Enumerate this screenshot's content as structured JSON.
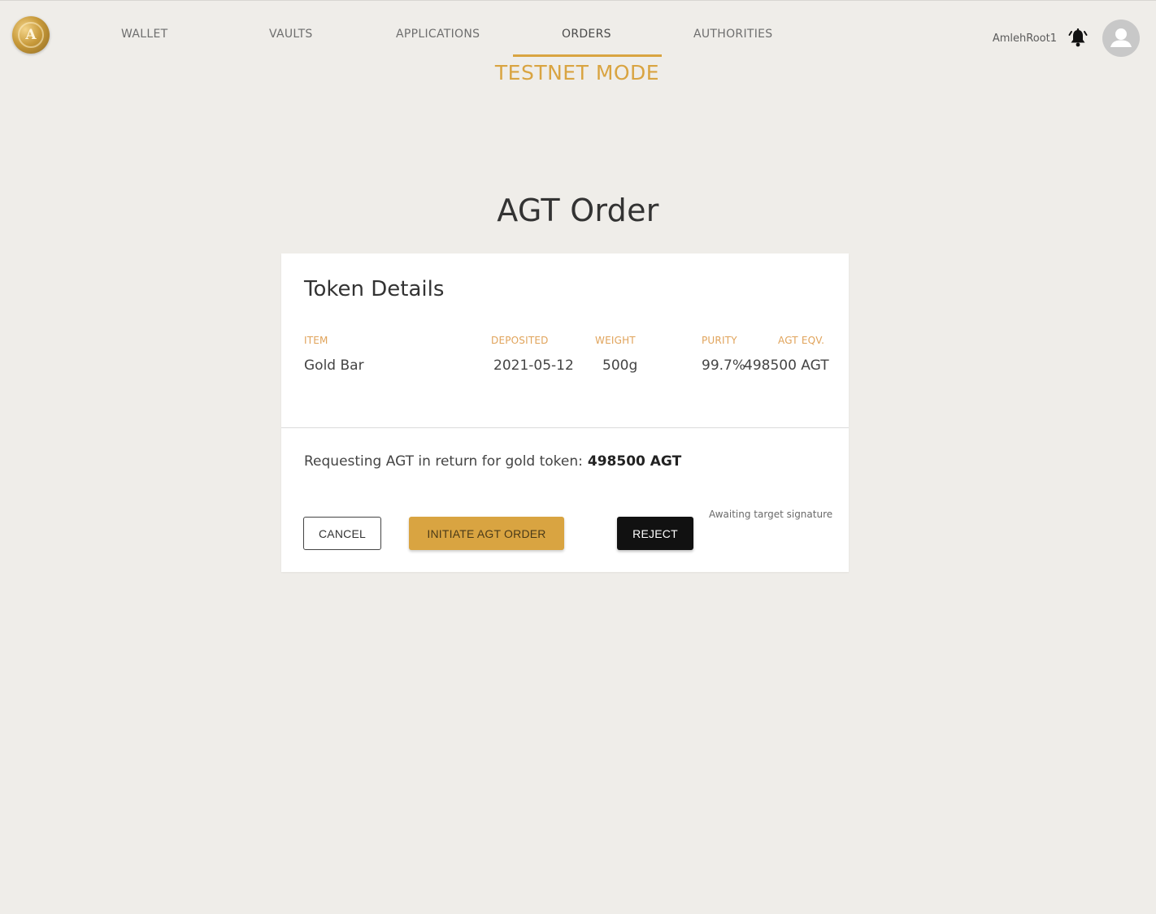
{
  "header": {
    "logo_letter": "A",
    "nav": [
      {
        "label": "WALLET"
      },
      {
        "label": "VAULTS"
      },
      {
        "label": "APPLICATIONS"
      },
      {
        "label": "ORDERS"
      },
      {
        "label": "AUTHORITIES"
      }
    ],
    "active_nav": "ORDERS",
    "mode_banner": "TESTNET MODE",
    "username": "AmlehRoot1",
    "icons": {
      "notifications": "bell-icon",
      "profile": "user-avatar-icon"
    }
  },
  "page": {
    "title": "AGT Order"
  },
  "card": {
    "title": "Token Details",
    "columns": [
      "ITEM",
      "DEPOSITED",
      "WEIGHT",
      "PURITY",
      "AGT EQV."
    ],
    "row": {
      "item": "Gold Bar",
      "deposited": "2021-05-12",
      "weight": "500g",
      "purity": "99.7%",
      "agt_eqv": "498500 AGT"
    },
    "request_text": "Requesting AGT in return for gold token:",
    "request_amount": "498500 AGT",
    "buttons": {
      "cancel": "CANCEL",
      "initiate": "INITIATE AGT ORDER",
      "reject": "REJECT"
    },
    "status": "Awaiting target signature"
  },
  "colors": {
    "accent": "#d9a441",
    "background": "#efede9",
    "card": "#ffffff",
    "reject": "#111111"
  }
}
